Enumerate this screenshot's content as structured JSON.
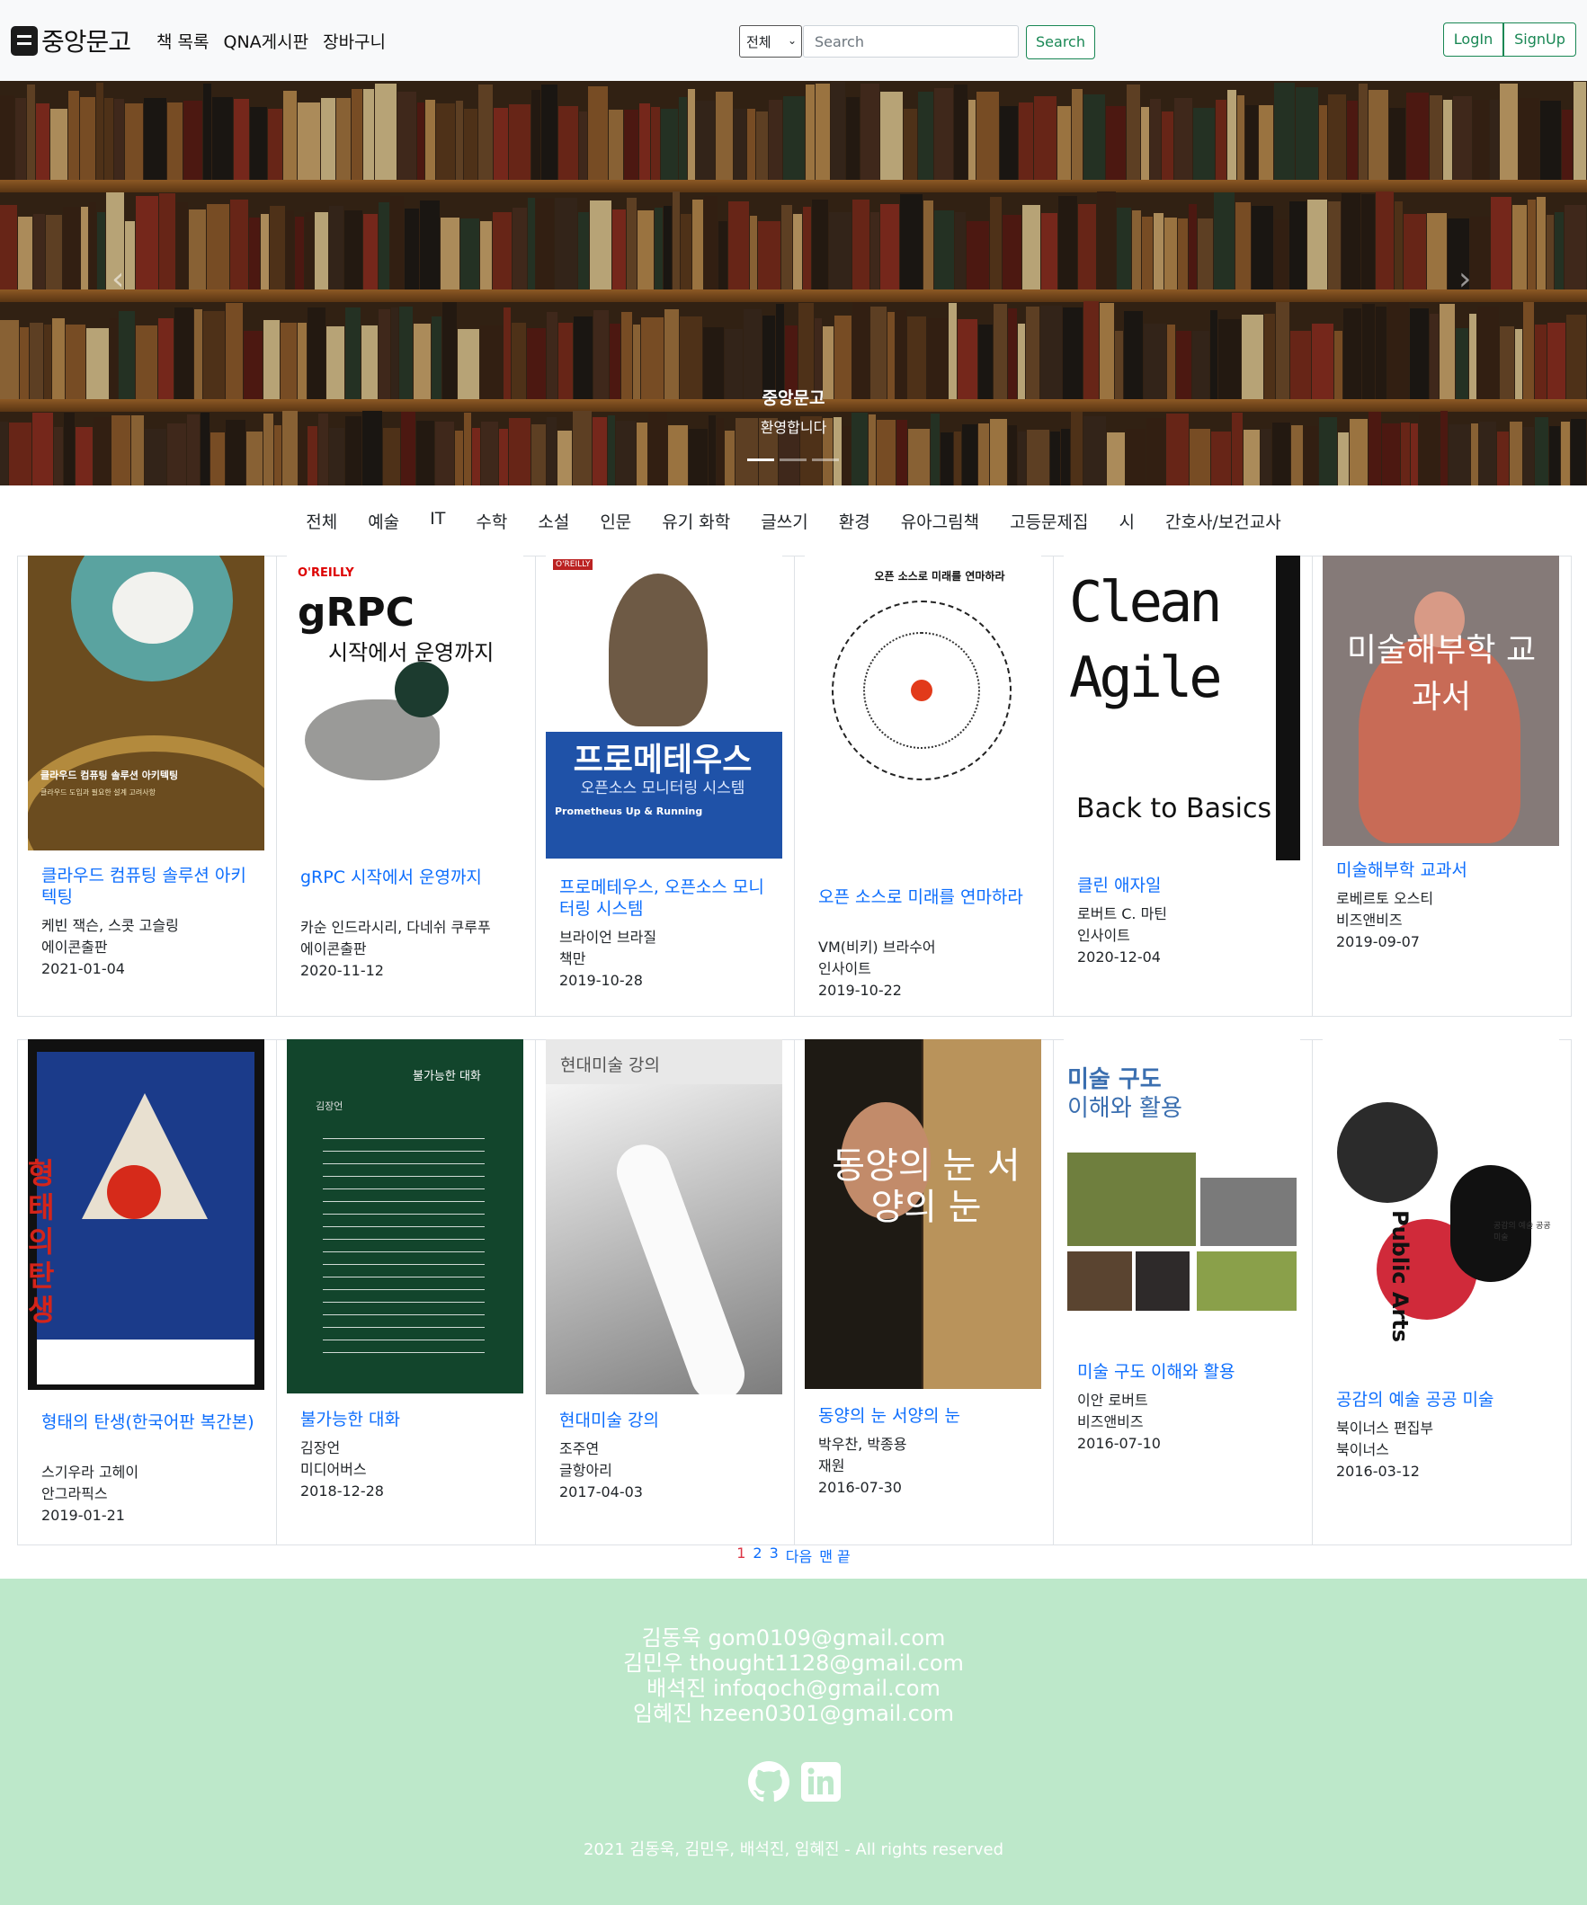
{
  "brand": {
    "name": "중앙문고"
  },
  "nav": {
    "items": [
      "책 목록",
      "QNA게시판",
      "장바구니"
    ]
  },
  "search": {
    "select_value": "전체",
    "placeholder": "Search",
    "button_label": "Search"
  },
  "auth": {
    "login_label": "LogIn",
    "signup_label": "SignUp"
  },
  "hero": {
    "title": "중앙문고",
    "subtitle": "환영합니다",
    "slides": 3,
    "active_slide": 1
  },
  "categories": [
    "전체",
    "예술",
    "IT",
    "수학",
    "소설",
    "인문",
    "유기 화학",
    "글쓰기",
    "환경",
    "유아그림책",
    "고등문제집",
    "시",
    "간호사/보건교사"
  ],
  "books": [
    {
      "title": "클라우드 컴퓨팅 솔루션 아키텍팅",
      "author": "케빈 잭슨, 스콧 고슬링",
      "publisher": "에이콘출판",
      "date": "2021-01-04",
      "cover_text": "클라우드 컴퓨팅 솔루션 아키텍팅",
      "cover_sub": "클라우드 도입과 필요한 설계 고려사항",
      "cover_bg": "#6b4c1f"
    },
    {
      "title": "gRPC 시작에서 운영까지",
      "author": "카순 인드라시리, 다네쉬 쿠루푸",
      "publisher": "에이콘출판",
      "date": "2020-11-12",
      "cover_text": "gRPC",
      "cover_sub": "시작에서 운영까지",
      "cover_logo": "O'REILLY",
      "cover_bg": "#ffffff"
    },
    {
      "title": "프로메테우스, 오픈소스 모니터링 시스템",
      "author": "브라이언 브라질",
      "publisher": "책만",
      "date": "2019-10-28",
      "cover_text": "프로메테우스",
      "cover_sub": "오픈소스 모니터링 시스템",
      "cover_logo": "O'REILLY",
      "cover_en": "Prometheus Up & Running",
      "cover_bg": "#1f52a8"
    },
    {
      "title": "오픈 소스로 미래를 연마하라",
      "author": "VM(비키) 브라수어",
      "publisher": "인사이트",
      "date": "2019-10-22",
      "cover_text": "오픈 소스로 미래를 연마하라",
      "cover_bg": "#ffffff"
    },
    {
      "title": "클린 애자일",
      "author": "로버트 C. 마틴",
      "publisher": "인사이트",
      "date": "2020-12-04",
      "cover_text": "Clean Agile",
      "cover_sub": "Back to Basics",
      "cover_bg": "#ffffff"
    },
    {
      "title": "미술해부학 교과서",
      "author": "로베르토 오스티",
      "publisher": "비즈앤비즈",
      "date": "2019-09-07",
      "cover_text": "미술해부학 교과서",
      "cover_bg": "#857a78"
    },
    {
      "title": "형태의 탄생(한국어판 복간본)",
      "author": "스기우라 고헤이",
      "publisher": "안그라픽스",
      "date": "2019-01-21",
      "cover_text": "형태의탄생",
      "cover_bg": "#111111"
    },
    {
      "title": "불가능한 대화",
      "author": "김장언",
      "publisher": "미디어버스",
      "date": "2018-12-28",
      "cover_text": "불가능한 대화",
      "cover_sub": "김장언",
      "cover_bg": "#12452c"
    },
    {
      "title": "현대미술 강의",
      "author": "조주연",
      "publisher": "글항아리",
      "date": "2017-04-03",
      "cover_text": "현대미술 강의",
      "cover_bg": "#e8e8e8"
    },
    {
      "title": "동양의 눈 서양의 눈",
      "author": "박우찬, 박종용",
      "publisher": "재원",
      "date": "2016-07-30",
      "cover_text": "동양의 눈 서양의 눈",
      "cover_bg": "#3b2a1c"
    },
    {
      "title": "미술 구도 이해와 활용",
      "author": "이안 로버트",
      "publisher": "비즈앤비즈",
      "date": "2016-07-10",
      "cover_text": "미술 구도",
      "cover_sub": "이해와 활용",
      "cover_bg": "#ffffff"
    },
    {
      "title": "공감의 예술 공공 미술",
      "author": "북이너스 편집부",
      "publisher": "북이너스",
      "date": "2016-03-12",
      "cover_text": "Public Arts",
      "cover_sub": "공감의 예술 공공 미술",
      "cover_bg": "#ffffff"
    }
  ],
  "pagination": {
    "pages": [
      "1",
      "2",
      "3"
    ],
    "next": "다음",
    "last": "맨 끝",
    "current": "1"
  },
  "footer": {
    "contacts": [
      "김동욱 gom0109@gmail.com",
      "김민우 thought1128@gmail.com",
      "배석진 infoqoch@gmail.com",
      "임혜진 hzeen0301@gmail.com"
    ],
    "icons": [
      "github-icon",
      "linkedin-icon"
    ],
    "copyright": "2021 김동욱, 김민우, 배석진, 임혜진 - All rights reserved"
  },
  "colors": {
    "accent": "#198754",
    "link": "#0d6efd",
    "current_page": "#dc3545",
    "footer_bg": "#bde8ca"
  }
}
